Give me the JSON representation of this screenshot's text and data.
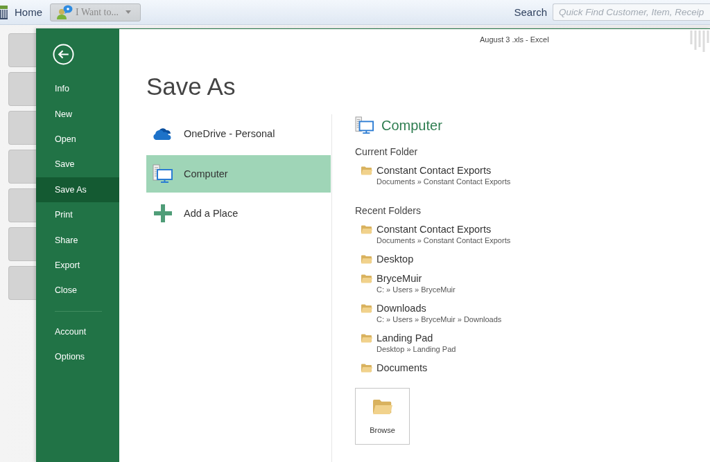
{
  "top_bar": {
    "home": "Home",
    "menu_button": "I Want to...",
    "search_label": "Search",
    "search": {
      "placeholder": "Quick Find Customer, Item, Receip"
    }
  },
  "window": {
    "title": "August 3 .xls - Excel"
  },
  "backstage_menu": {
    "items": [
      {
        "label": "Info",
        "selected": false
      },
      {
        "label": "New",
        "selected": false
      },
      {
        "label": "Open",
        "selected": false
      },
      {
        "label": "Save",
        "selected": false
      },
      {
        "label": "Save As",
        "selected": true
      },
      {
        "label": "Print",
        "selected": false
      },
      {
        "label": "Share",
        "selected": false
      },
      {
        "label": "Export",
        "selected": false
      },
      {
        "label": "Close",
        "selected": false
      }
    ],
    "bottom_items": [
      {
        "label": "Account",
        "selected": false
      },
      {
        "label": "Options",
        "selected": false
      }
    ]
  },
  "page_title": "Save As",
  "places": [
    {
      "label": "OneDrive - Personal",
      "kind": "cloud",
      "selected": false
    },
    {
      "label": "Computer",
      "kind": "computer",
      "selected": true
    },
    {
      "label": "Add a Place",
      "kind": "add",
      "selected": false
    }
  ],
  "location": {
    "heading": "Computer",
    "current_folder": {
      "title": "Current Folder",
      "folders": [
        {
          "name": "Constant Contact Exports",
          "path": "Documents » Constant Contact Exports"
        }
      ]
    },
    "recent_folders": {
      "title": "Recent Folders",
      "folders": [
        {
          "name": "Constant Contact Exports",
          "path": "Documents » Constant Contact Exports"
        },
        {
          "name": "Desktop"
        },
        {
          "name": "BryceMuir",
          "path": "C: » Users » BryceMuir"
        },
        {
          "name": "Downloads",
          "path": "C: » Users » BryceMuir » Downloads"
        },
        {
          "name": "Landing Pad",
          "path": "Desktop » Landing Pad"
        },
        {
          "name": "Documents"
        }
      ]
    },
    "browse_button": "Browse"
  }
}
